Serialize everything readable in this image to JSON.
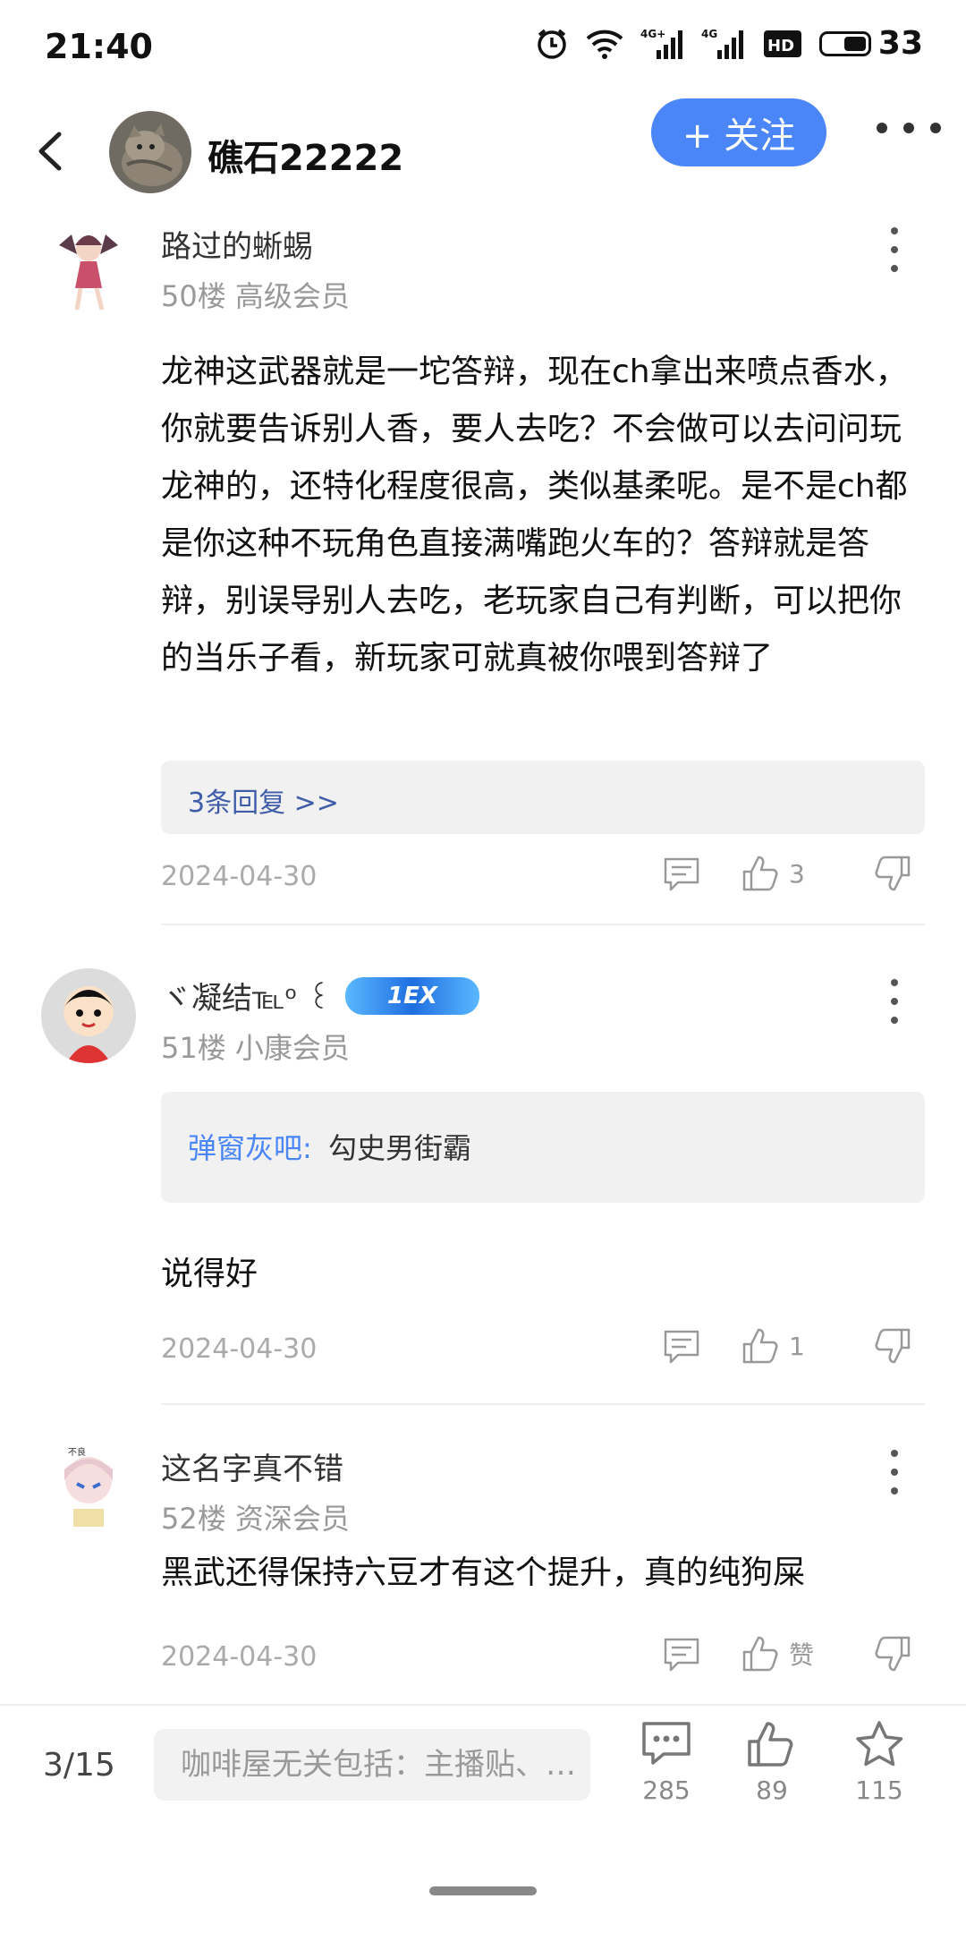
{
  "status_bar": {
    "time": "21:40",
    "battery": "33",
    "icons": [
      "alarm-icon",
      "wifi-icon",
      "signal-4g-icon",
      "signal-4g-icon",
      "hd-icon",
      "battery-icon"
    ]
  },
  "header": {
    "user_name": "礁石22222",
    "follow_label": "+ 关注"
  },
  "comments": [
    {
      "user": "路过的蜥蜴",
      "meta": "50楼 高级会员",
      "body": "龙神这武器就是一坨答辩，现在ch拿出来喷点香水，你就要告诉别人香，要人去吃？不会做可以去问问玩龙神的，还特化程度很高，类似基柔呢。是不是ch都是你这种不玩角色直接满嘴跑火车的？答辩就是答辩，别误导别人去吃，老玩家自己有判断，可以把你的当乐子看，新玩家可就真被你喂到答辩了",
      "replies": "3条回复 >>",
      "date": "2024-04-30",
      "likes": "3"
    },
    {
      "user": "ヾ凝结℡ᵒ ꒰",
      "badge": "1EX",
      "meta": "51楼 小康会员",
      "quote_author": "弹窗灰吧:",
      "quote_text": "勾史男街霸",
      "body": "说得好",
      "date": "2024-04-30",
      "likes": "1"
    },
    {
      "user": "这名字真不错",
      "meta": "52楼 资深会员",
      "body": "黑武还得保持六豆才有这个提升，真的纯狗屎",
      "date": "2024-04-30",
      "likes": "赞"
    }
  ],
  "bottom_bar": {
    "page": "3/15",
    "input_placeholder": "咖啡屋无关包括：主播贴、…",
    "comments_count": "285",
    "likes_count": "89",
    "favorites_count": "115"
  },
  "colors": {
    "accent": "#4a86f7",
    "reply_link": "#3f5ca8",
    "meta_gray": "#999999"
  }
}
